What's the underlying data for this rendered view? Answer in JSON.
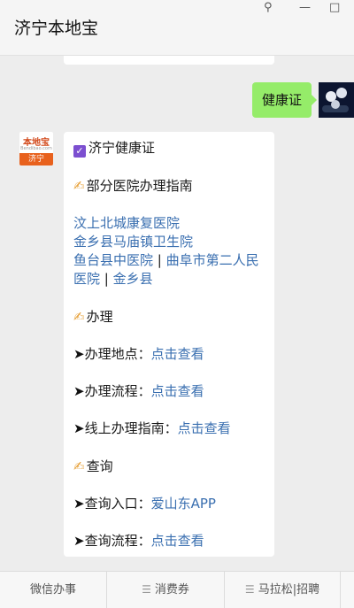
{
  "window": {
    "title": "济宁本地宝",
    "pin_glyph": "⚲",
    "minimize_glyph": "—",
    "maximize_glyph": "□"
  },
  "chat": {
    "prev_card_cut_text": "…  …  …",
    "my_message": "健康证",
    "bot_avatar": {
      "brand": "本地宝",
      "url": "Bendibao.com",
      "city": "济宁"
    },
    "card": {
      "title": "济宁健康证",
      "section1": "部分医院办理指南",
      "hospital_line1": "汶上北城康复医院",
      "hospital_line2": "金乡县马庙镇卫生院",
      "hospital_line3_a": "鱼台县中医院",
      "sep": " | ",
      "hospital_line3_b": "曲阜市第二人民",
      "hospital_line4_a": "医院",
      "hospital_line4_b": "金乡县",
      "section2": "办理",
      "row1_label": "办理地点：",
      "row1_link": "点击查看",
      "row2_label": "办理流程：",
      "row2_link": "点击查看",
      "row3_label": "线上办理指南：",
      "row3_link": "点击查看",
      "section3": "查询",
      "row4_label": "查询入口：",
      "row4_link": "爱山东APP",
      "row5_label": "查询流程：",
      "row5_link": "点击查看"
    }
  },
  "menu": {
    "item1": "微信办事",
    "item2": "消费券",
    "item3": "马拉松|招聘"
  },
  "colors": {
    "link": "#3a6fb0",
    "my_bubble": "#95ec69",
    "check_badge": "#7c4fd0"
  }
}
